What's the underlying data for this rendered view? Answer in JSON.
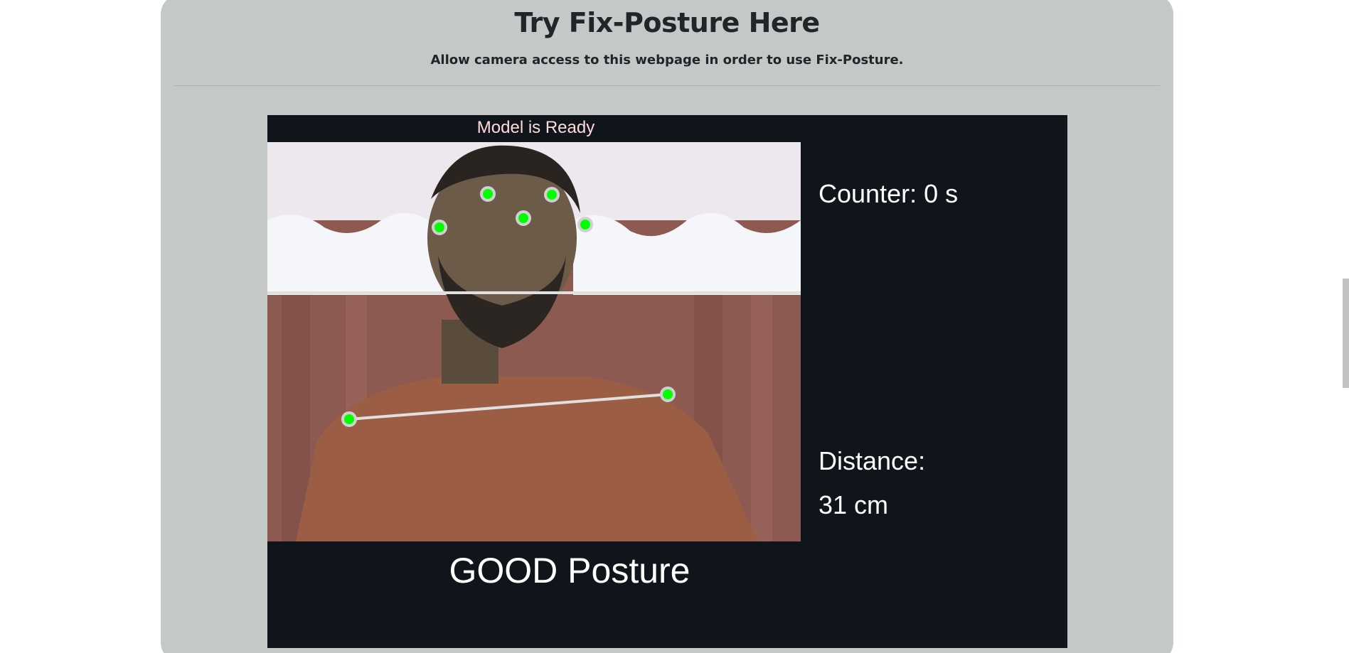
{
  "section": {
    "title": "Try Fix-Posture Here",
    "subtitle": "Allow camera access to this webpage in order to use Fix-Posture."
  },
  "app": {
    "model_status": "Model is Ready",
    "counter_label": "Counter:",
    "counter_value": "0 s",
    "distance_label": "Distance:",
    "distance_value": "31 cm",
    "posture_status": "GOOD Posture",
    "keypoint_color": "#00ff00",
    "skeleton_color": "#e0e0e0"
  }
}
